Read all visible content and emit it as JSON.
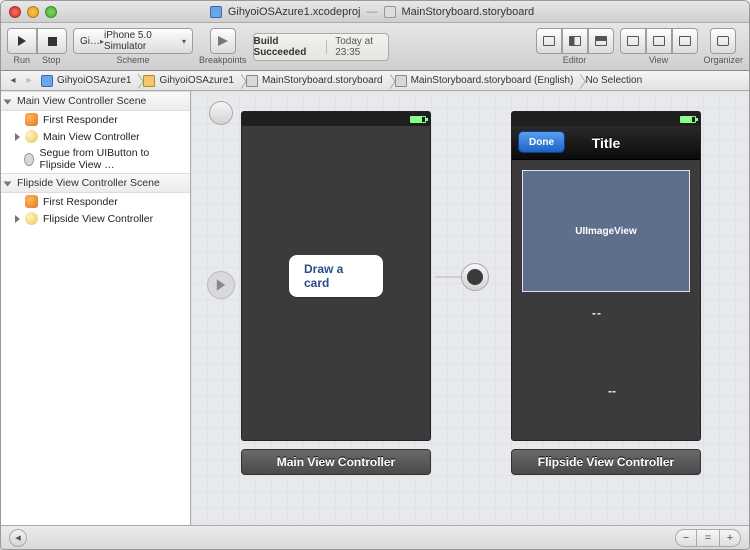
{
  "titlebar": {
    "project_file": "GihyoiOSAzure1.xcodeproj",
    "doc_file": "MainStoryboard.storyboard",
    "separator": "—"
  },
  "toolbar": {
    "run_label": "Run",
    "stop_label": "Stop",
    "scheme_label": "Scheme",
    "scheme_target": "Gi…",
    "scheme_dest": "iPhone 5.0 Simulator",
    "breakpoints_label": "Breakpoints",
    "lcd_status": "Build Succeeded",
    "lcd_time": "Today at 23:35",
    "editor_label": "Editor",
    "view_label": "View",
    "organizer_label": "Organizer"
  },
  "jumpbar": {
    "items": [
      {
        "icon": "ji-proj",
        "label": "GihyoiOSAzure1"
      },
      {
        "icon": "ji-fold",
        "label": "GihyoiOSAzure1"
      },
      {
        "icon": "ji-sb",
        "label": "MainStoryboard.storyboard"
      },
      {
        "icon": "ji-sb",
        "label": "MainStoryboard.storyboard (English)"
      },
      {
        "icon": "",
        "label": "No Selection"
      }
    ]
  },
  "outline": {
    "groups": [
      {
        "title": "Main View Controller Scene",
        "rows": [
          {
            "icon": "oi-fr",
            "label": "First Responder",
            "expandable": false
          },
          {
            "icon": "oi-vc",
            "label": "Main View Controller",
            "expandable": true
          },
          {
            "icon": "oi-seg",
            "label": "Segue from UIButton to Flipside View …",
            "expandable": false
          }
        ]
      },
      {
        "title": "Flipside View Controller Scene",
        "rows": [
          {
            "icon": "oi-fr",
            "label": "First Responder",
            "expandable": false
          },
          {
            "icon": "oi-vc",
            "label": "Flipside View Controller",
            "expandable": true
          }
        ]
      }
    ]
  },
  "canvas": {
    "scene1": {
      "label": "Main View Controller",
      "button": "Draw a card"
    },
    "scene2": {
      "label": "Flipside View Controller",
      "navtitle": "Title",
      "done": "Done",
      "imgview": "UIImageView",
      "l1": "--",
      "l2": "",
      "l3": "--"
    }
  },
  "footer": {
    "zoom_out": "−",
    "zoom_reset": "=",
    "zoom_in": "+",
    "back": "◂"
  }
}
